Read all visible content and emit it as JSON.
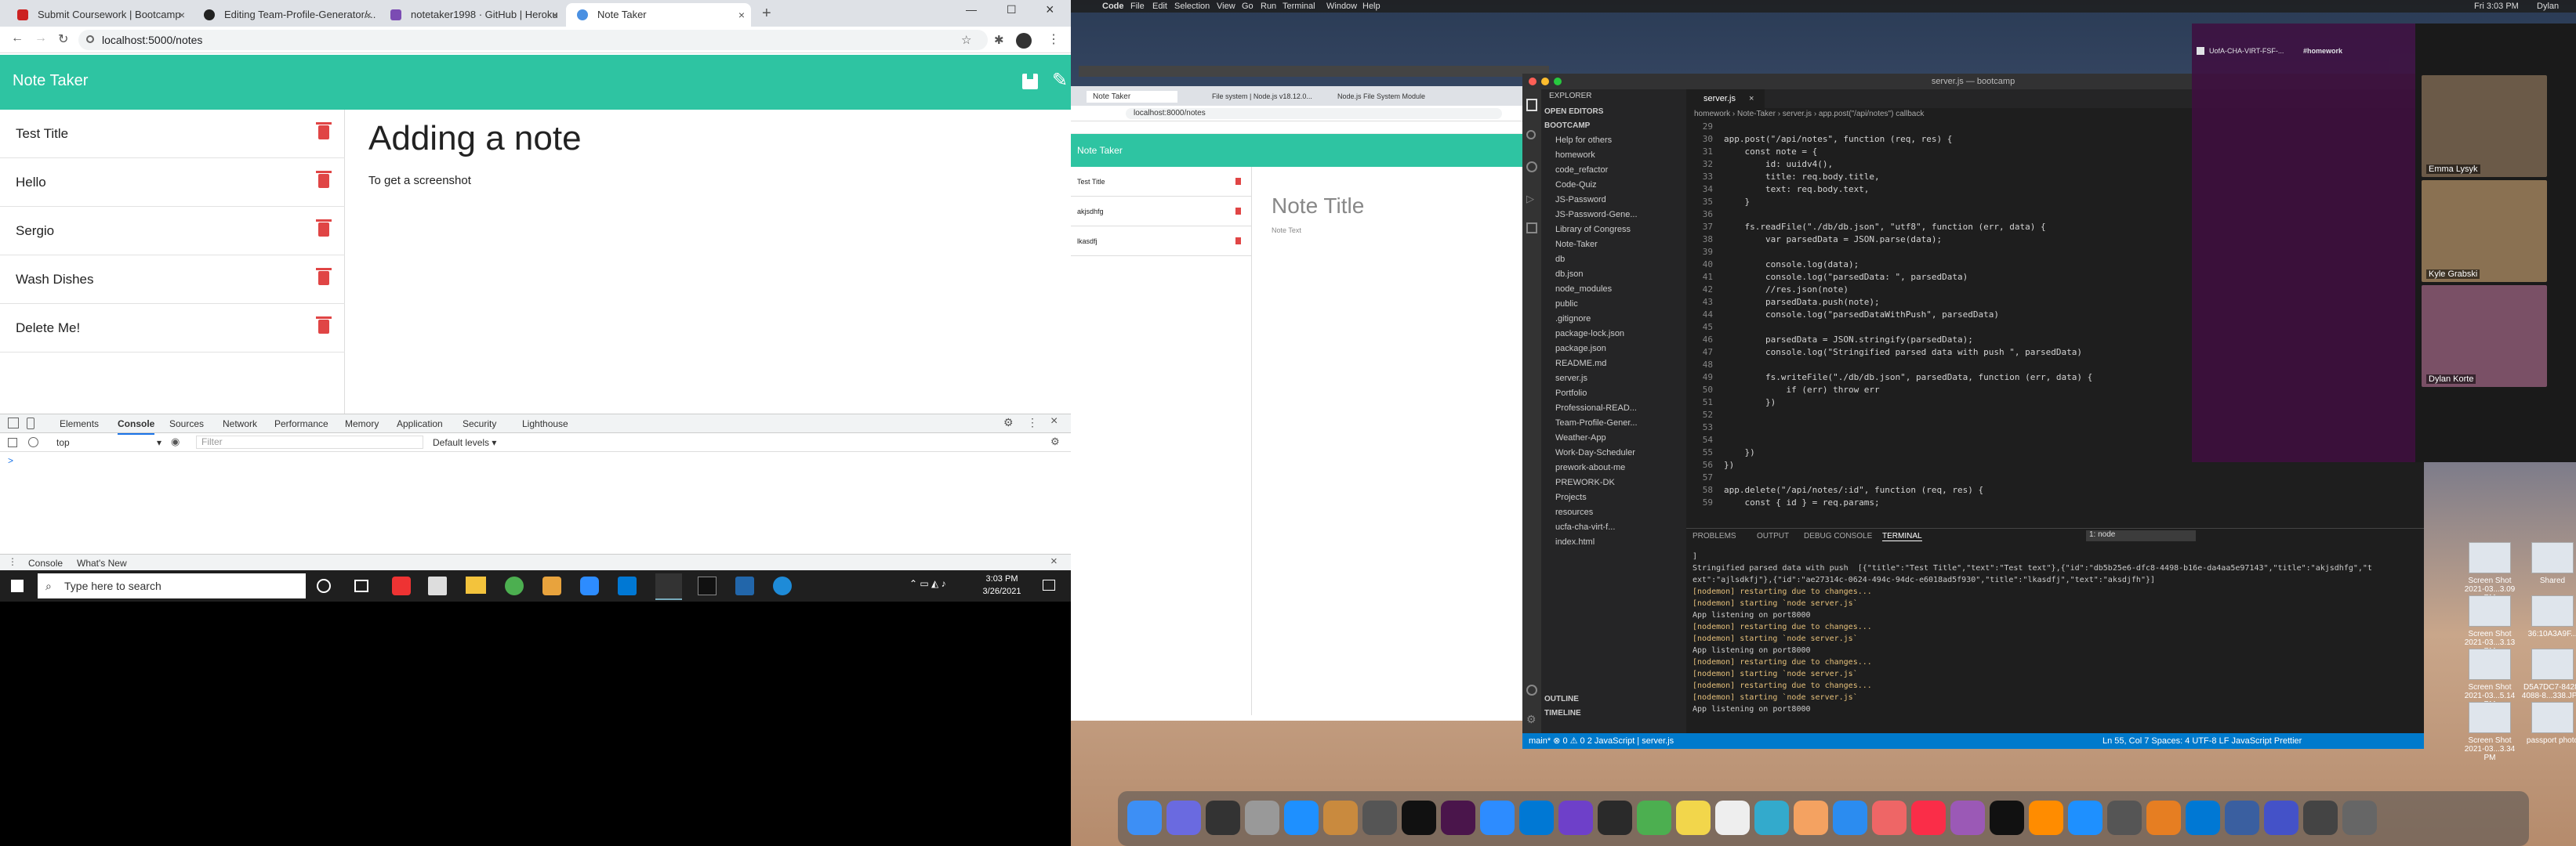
{
  "browser": {
    "tabs": [
      {
        "label": "Submit Coursework | Bootcamp",
        "fav_color": "#c22"
      },
      {
        "label": "Editing Team-Profile-Generator/...",
        "fav_color": "#222"
      },
      {
        "label": "notetaker1998 · GitHub | Heroku",
        "fav_color": "#7b4bb3"
      },
      {
        "label": "Note Taker",
        "fav_color": "#4a90e2"
      }
    ],
    "url": "localhost:5000/notes"
  },
  "note_taker": {
    "title": "Note Taker",
    "notes": [
      "Test Title",
      "Hello",
      "Sergio",
      "Wash Dishes",
      "Delete Me!"
    ],
    "active_title": "Adding a note",
    "active_text": "To get a screenshot"
  },
  "devtools": {
    "tabs": [
      "Elements",
      "Console",
      "Sources",
      "Network",
      "Performance",
      "Memory",
      "Application",
      "Security",
      "Lighthouse"
    ],
    "context": "top",
    "filter_placeholder": "Filter",
    "levels": "Default levels ▾",
    "prompt": ">",
    "drawer_tabs": [
      "Console",
      "What's New"
    ]
  },
  "windows_taskbar": {
    "search_placeholder": "Type here to search",
    "time": "3:03 PM",
    "date": "3/26/2021"
  },
  "mac": {
    "menu": [
      "Code",
      "File",
      "Edit",
      "Selection",
      "View",
      "Go",
      "Run",
      "Terminal",
      "Window",
      "Help"
    ],
    "clock": "Fri 3:03 PM",
    "user": "Dylan"
  },
  "bg_browser": {
    "tabs": [
      "Note Taker",
      "File system | Node.js v18.12.0...",
      "Node.js File System Module"
    ],
    "url": "localhost:8000/notes",
    "header": "Note Taker",
    "notes": [
      "Test Title",
      "akjsdhfg",
      "lkasdfj"
    ],
    "active_title": "Note Title",
    "active_text": "Note Text"
  },
  "vscode": {
    "title": "server.js — bootcamp",
    "explorer_label": "EXPLORER",
    "open_editors": "OPEN EDITORS",
    "workspace": "BOOTCAMP",
    "tab": "server.js",
    "breadcrumb": "homework › Note-Taker › server.js › app.post(\"/api/notes\") callback",
    "tree": [
      "Help for others",
      "homework",
      "code_refactor",
      "Code-Quiz",
      "JS-Password",
      "JS-Password-Gene...",
      "Library of Congress",
      "Note-Taker",
      "db",
      "db.json",
      "node_modules",
      "public",
      ".gitignore",
      "package-lock.json",
      "package.json",
      "README.md",
      "server.js",
      "Portfolio",
      "Professional-READ...",
      "Team-Profile-Gener...",
      "Weather-App",
      "Work-Day-Scheduler",
      "prework-about-me",
      "PREWORK-DK",
      "Projects",
      "resources",
      "ucfa-cha-virt-f...",
      "index.html"
    ],
    "outline": "OUTLINE",
    "timeline": "TIMELINE",
    "code": [
      {
        "n": "29",
        "t": ""
      },
      {
        "n": "30",
        "t": "app.post(\"/api/notes\", function (req, res) {"
      },
      {
        "n": "31",
        "t": "    const note = {"
      },
      {
        "n": "32",
        "t": "        id: uuidv4(),"
      },
      {
        "n": "33",
        "t": "        title: req.body.title,"
      },
      {
        "n": "34",
        "t": "        text: req.body.text,"
      },
      {
        "n": "35",
        "t": "    }"
      },
      {
        "n": "36",
        "t": ""
      },
      {
        "n": "37",
        "t": "    fs.readFile(\"./db/db.json\", \"utf8\", function (err, data) {"
      },
      {
        "n": "38",
        "t": "        var parsedData = JSON.parse(data);"
      },
      {
        "n": "39",
        "t": ""
      },
      {
        "n": "40",
        "t": "        console.log(data);"
      },
      {
        "n": "41",
        "t": "        console.log(\"parsedData: \", parsedData)"
      },
      {
        "n": "42",
        "t": "        //res.json(note)"
      },
      {
        "n": "43",
        "t": "        parsedData.push(note);"
      },
      {
        "n": "44",
        "t": "        console.log(\"parsedDataWithPush\", parsedData)"
      },
      {
        "n": "45",
        "t": ""
      },
      {
        "n": "46",
        "t": "        parsedData = JSON.stringify(parsedData);"
      },
      {
        "n": "47",
        "t": "        console.log(\"Stringified parsed data with push \", parsedData)"
      },
      {
        "n": "48",
        "t": ""
      },
      {
        "n": "49",
        "t": "        fs.writeFile(\"./db/db.json\", parsedData, function (err, data) {"
      },
      {
        "n": "50",
        "t": "            if (err) throw err"
      },
      {
        "n": "51",
        "t": "        })"
      },
      {
        "n": "52",
        "t": ""
      },
      {
        "n": "53",
        "t": ""
      },
      {
        "n": "54",
        "t": ""
      },
      {
        "n": "55",
        "t": "    })"
      },
      {
        "n": "56",
        "t": "})"
      },
      {
        "n": "57",
        "t": ""
      },
      {
        "n": "58",
        "t": "app.delete(\"/api/notes/:id\", function (req, res) {"
      },
      {
        "n": "59",
        "t": "    const { id } = req.params;"
      }
    ],
    "panel_tabs": [
      "PROBLEMS",
      "OUTPUT",
      "DEBUG CONSOLE",
      "TERMINAL"
    ],
    "terminal_select": "1: node",
    "terminal": [
      "]",
      "Stringified parsed data with push  [{\"title\":\"Test Title\",\"text\":\"Test text\"},{\"id\":\"db5b25e6-dfc8-4498-b16e-da4aa5e97143\",\"title\":\"akjsdhfg\",\"t",
      "ext\":\"ajlsdkfj\"},{\"id\":\"ae27314c-0624-494c-94dc-e6018ad5f930\",\"title\":\"lkasdfj\",\"text\":\"aksdjfh\"}]",
      "[nodemon] restarting due to changes...",
      "[nodemon] starting `node server.js`",
      "App listening on port8000",
      "[nodemon] restarting due to changes...",
      "[nodemon] starting `node server.js`",
      "App listening on port8000",
      "[nodemon] restarting due to changes...",
      "[nodemon] starting `node server.js`",
      "[nodemon] restarting due to changes...",
      "[nodemon] starting `node server.js`",
      "App listening on port8000"
    ],
    "status_left": "main*   ⊗ 0 ⚠ 0 2   JavaScript | server.js",
    "status_right": "Ln 55, Col 7   Spaces: 4   UTF-8   LF   JavaScript   Prettier"
  },
  "zoom": {
    "participants": [
      "Emma Lysyk",
      "Kyle Grabski",
      "Dylan Korte"
    ]
  },
  "slack": {
    "channel": "#homework",
    "workspace": "UofA-CHA-VIRT-FSF-..."
  },
  "desktop_files": [
    "Screen Shot 2021-03...3.09 PM",
    "Shared",
    "Screen Shot 2021-03...3.13 PM",
    "36:10A3A9F...",
    "Screen Shot 2021-03...5.14 PM",
    "D5A7DC7-8428-4088-8...338.JPG",
    "Screen Shot 2021-03...3.34 PM",
    "passport photo"
  ],
  "colors": {
    "note_teal": "#2ec4a2",
    "trash_red": "#e04545",
    "vscode_blue": "#007acc"
  }
}
